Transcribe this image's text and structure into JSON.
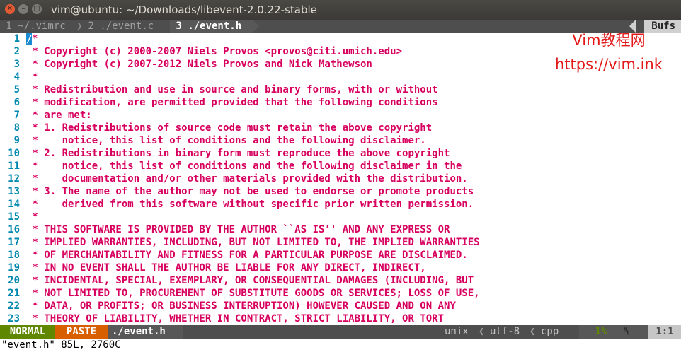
{
  "window": {
    "title": "vim@ubuntu: ~/Downloads/libevent-2.0.22-stable",
    "close_glyph": "✕",
    "minimize_glyph": "–",
    "maximize_glyph": "▢"
  },
  "tabline": {
    "tabs": [
      {
        "label": " 1 ~/.vimrc "
      },
      {
        "label": " 2 ./event.c "
      },
      {
        "label": " 3 ./event.h "
      }
    ],
    "separator": "❯",
    "bufs_label": "Bufs"
  },
  "editor": {
    "line_numbers": [
      "1",
      "2",
      "3",
      "4",
      "5",
      "6",
      "7",
      "8",
      "9",
      "10",
      "11",
      "12",
      "13",
      "14",
      "15",
      "16",
      "17",
      "18",
      "19",
      "20",
      "21",
      "22",
      "23"
    ],
    "lines": [
      "*",
      " * Copyright (c) 2000-2007 Niels Provos <provos@citi.umich.edu>",
      " * Copyright (c) 2007-2012 Niels Provos and Nick Mathewson",
      " *",
      " * Redistribution and use in source and binary forms, with or without",
      " * modification, are permitted provided that the following conditions",
      " * are met:",
      " * 1. Redistributions of source code must retain the above copyright",
      " *    notice, this list of conditions and the following disclaimer.",
      " * 2. Redistributions in binary form must reproduce the above copyright",
      " *    notice, this list of conditions and the following disclaimer in the",
      " *    documentation and/or other materials provided with the distribution.",
      " * 3. The name of the author may not be used to endorse or promote products",
      " *    derived from this software without specific prior written permission.",
      " *",
      " * THIS SOFTWARE IS PROVIDED BY THE AUTHOR ``AS IS'' AND ANY EXPRESS OR",
      " * IMPLIED WARRANTIES, INCLUDING, BUT NOT LIMITED TO, THE IMPLIED WARRANTIES",
      " * OF MERCHANTABILITY AND FITNESS FOR A PARTICULAR PURPOSE ARE DISCLAIMED.",
      " * IN NO EVENT SHALL THE AUTHOR BE LIABLE FOR ANY DIRECT, INDIRECT,",
      " * INCIDENTAL, SPECIAL, EXEMPLARY, OR CONSEQUENTIAL DAMAGES (INCLUDING, BUT",
      " * NOT LIMITED TO, PROCUREMENT OF SUBSTITUTE GOODS OR SERVICES; LOSS OF USE,",
      " * DATA, OR PROFITS; OR BUSINESS INTERRUPTION) HOWEVER CAUSED AND ON ANY",
      " * THEORY OF LIABILITY, WHETHER IN CONTRACT, STRICT LIABILITY, OR TORT"
    ],
    "cursor_char": "/"
  },
  "watermark": {
    "line1": "Vim教程网",
    "line2": "https://vim.ink"
  },
  "statusline": {
    "mode": "NORMAL",
    "paste": "PASTE",
    "filename": "./event.h",
    "fileformat": "unix",
    "encoding": "utf-8",
    "filetype": "cpp",
    "percent": "1%",
    "line_icon": "␤",
    "position": "1:1",
    "chevron": "❮"
  },
  "cmdline": {
    "text": "\"event.h\" 85L, 2760C"
  },
  "colors": {
    "comment": "#d7005f",
    "line_number": "#0087af",
    "cursor": "#1c8ad1",
    "mode_bg": "#5f8700",
    "paste_bg": "#d75f00",
    "watermark": "#e31a1a"
  }
}
